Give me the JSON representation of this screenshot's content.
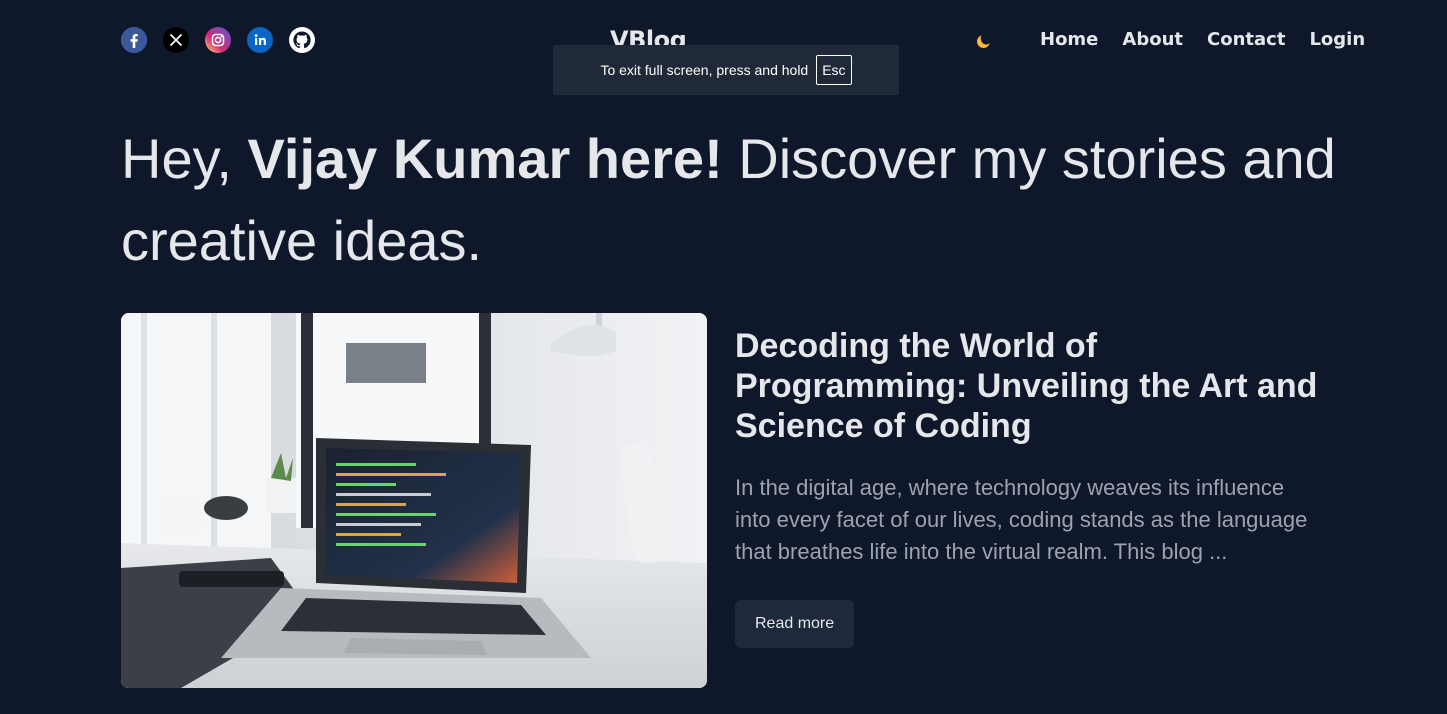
{
  "header": {
    "logo": "VBlog",
    "socials": [
      {
        "name": "facebook-icon",
        "color": "#3b5998"
      },
      {
        "name": "x-icon",
        "color": "#000000"
      },
      {
        "name": "instagram-icon",
        "color": "#e1306c"
      },
      {
        "name": "linkedin-icon",
        "color": "#0a66c2"
      },
      {
        "name": "github-icon",
        "color": "#ffffff"
      }
    ],
    "theme_icon": "moon-icon",
    "theme_icon_color": "#f6b93b",
    "nav": {
      "home": "Home",
      "about": "About",
      "contact": "Contact",
      "login": "Login"
    }
  },
  "toast": {
    "message": "To exit full screen, press and hold",
    "key": "Esc"
  },
  "hero": {
    "prefix": "Hey, ",
    "name": "Vijay Kumar here!",
    "suffix": " Discover my stories and creative ideas."
  },
  "featured_post": {
    "image": "laptop-desk-photo",
    "title": "Decoding the World of Programming: Unveiling the Art and Science of Coding",
    "excerpt": "In the digital age, where technology weaves its influence into every facet of our lives, coding stands as the language that breathes life into the virtual realm. This blog ...",
    "read_more": "Read more"
  },
  "colors": {
    "background": "#0f172a",
    "text": "#e5e7eb",
    "muted": "#9ca3af",
    "button": "#1e293b"
  }
}
